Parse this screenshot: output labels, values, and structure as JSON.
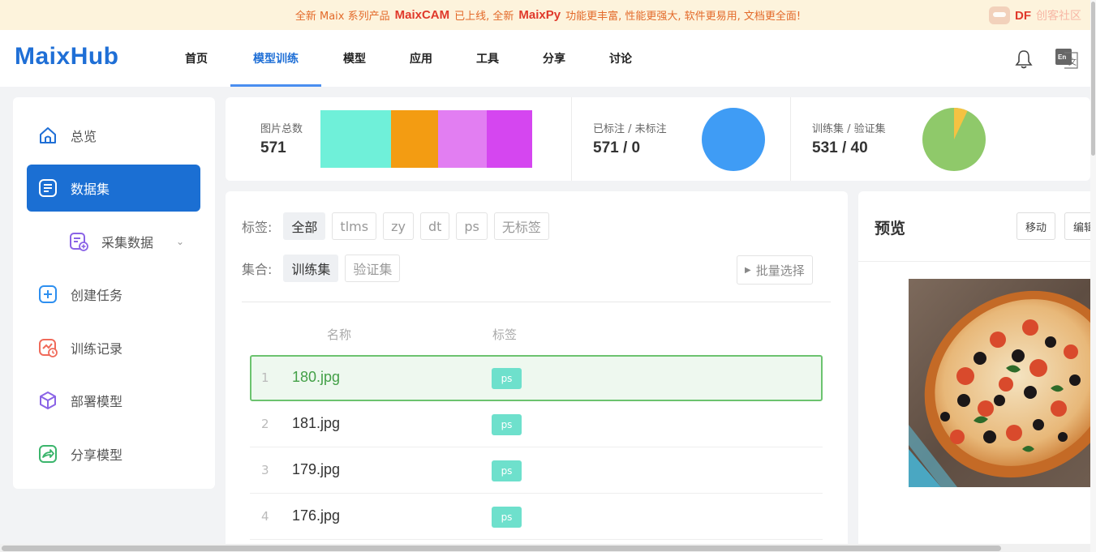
{
  "banner": {
    "prefix": "全新 Maix 系列产品",
    "product1": "MaixCAM",
    "middle": "已上线, 全新",
    "product2": "MaixPy",
    "suffix": "功能更丰富, 性能更强大, 软件更易用, 文档更全面!",
    "partner": "DF",
    "partner_sub": "创客社区"
  },
  "header": {
    "brand": "MaixHub",
    "nav": [
      "首页",
      "模型训练",
      "模型",
      "应用",
      "工具",
      "分享",
      "讨论"
    ],
    "active_nav": "模型训练",
    "lang_icon": "En文"
  },
  "sidebar": {
    "items": [
      {
        "label": "总览",
        "icon": "home-icon"
      },
      {
        "label": "数据集",
        "icon": "list-icon",
        "active": true
      },
      {
        "label": "采集数据",
        "icon": "add-file-icon"
      },
      {
        "label": "创建任务",
        "icon": "plus-square-icon"
      },
      {
        "label": "训练记录",
        "icon": "chart-record-icon"
      },
      {
        "label": "部署模型",
        "icon": "cube-icon"
      },
      {
        "label": "分享模型",
        "icon": "share-icon"
      }
    ]
  },
  "stats": {
    "total_label": "图片总数",
    "total_value": "571",
    "labeled_label": "已标注 / 未标注",
    "labeled_value": "571 / 0",
    "split_label": "训练集 / 验证集",
    "split_value": "531 / 40",
    "tag_distribution_colors": [
      "#6ff0d9",
      "#f39c12",
      "#e27ef2",
      "#d546f0"
    ],
    "labeled_fraction": 1.0,
    "train_fraction": 0.93,
    "colors": {
      "labeled": "#3f9cf5",
      "train": "#8fc96a",
      "val": "#f5c242"
    }
  },
  "filters": {
    "tag_label": "标签:",
    "tags": [
      "全部",
      "tlms",
      "zy",
      "dt",
      "ps",
      "无标签"
    ],
    "active_tag": "全部",
    "set_label": "集合:",
    "sets": [
      "训练集",
      "验证集"
    ],
    "active_set": "训练集",
    "batch_select": "批量选择"
  },
  "table": {
    "headers": [
      "名称",
      "标签"
    ],
    "rows": [
      {
        "index": "1",
        "name": "180.jpg",
        "tag": "ps"
      },
      {
        "index": "2",
        "name": "181.jpg",
        "tag": "ps"
      },
      {
        "index": "3",
        "name": "179.jpg",
        "tag": "ps"
      },
      {
        "index": "4",
        "name": "176.jpg",
        "tag": "ps"
      }
    ]
  },
  "preview": {
    "title": "预览",
    "move_button": "移动",
    "edit_button": "编辑"
  }
}
